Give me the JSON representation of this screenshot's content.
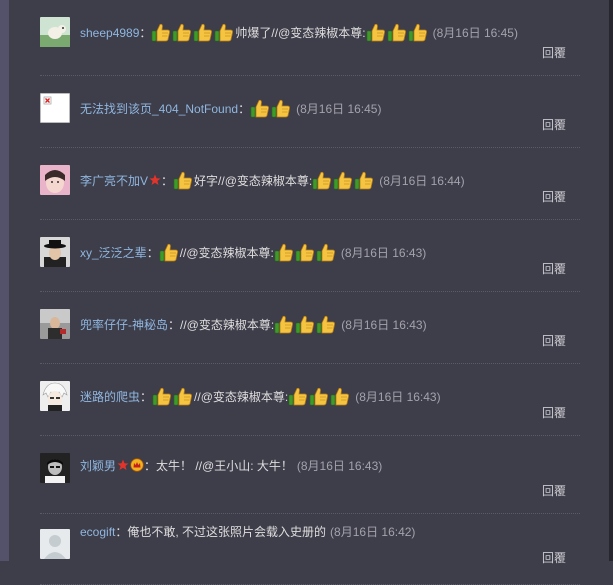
{
  "comments": [
    {
      "user": "sheep4989",
      "suffix": "：",
      "thumbs_a": 4,
      "text": "帅爆了//@变态辣椒本尊:",
      "thumbs_b": 3,
      "time": "(8月16日 16:45)",
      "reply": "回覆",
      "avatar": "sheep-avatar"
    },
    {
      "user": "无法找到该页_404_NotFound",
      "suffix": "：",
      "thumbs_a": 2,
      "text": "",
      "thumbs_b": 0,
      "time": "(8月16日 16:45)",
      "reply": "回覆",
      "avatar": "broken-image-avatar"
    },
    {
      "user": "李广亮不加V",
      "suffix": "：",
      "thumbs_a": 1,
      "text": "好字//@变态辣椒本尊:",
      "thumbs_b": 3,
      "time": "(8月16日 16:44)",
      "reply": "回覆",
      "avatar": "girl-avatar",
      "badge": "star-badge"
    },
    {
      "user": "xy_泛泛之辈",
      "suffix": "：",
      "thumbs_a": 1,
      "text": "//@变态辣椒本尊:",
      "thumbs_b": 3,
      "time": "(8月16日 16:43)",
      "reply": "回覆",
      "avatar": "hat-avatar"
    },
    {
      "user": "兜率仔仔-神秘岛",
      "suffix": "：",
      "thumbs_a": 0,
      "text": "//@变态辣椒本尊:",
      "thumbs_b": 3,
      "time": "(8月16日 16:43)",
      "reply": "回覆",
      "avatar": "photo-avatar"
    },
    {
      "user": "迷路的爬虫",
      "suffix": "：",
      "thumbs_a": 2,
      "text": "//@变态辣椒本尊:",
      "thumbs_b": 3,
      "time": "(8月16日 16:43)",
      "reply": "回覆",
      "avatar": "anime-avatar"
    },
    {
      "user": "刘颖男",
      "suffix": "：",
      "thumbs_a": 0,
      "text": "太牛！ //@王小山: 大牛！",
      "thumbs_b": 0,
      "time": "(8月16日 16:43)",
      "reply": "回覆",
      "avatar": "bw-avatar",
      "badge": "star-badge",
      "badge2": "crown-badge"
    },
    {
      "user": "ecogift",
      "suffix": "：",
      "thumbs_a": 0,
      "text": "俺也不敢, 不过这张照片会载入史册的",
      "thumbs_b": 0,
      "time": "(8月16日 16:42)",
      "reply": "回覆",
      "avatar": "default-avatar"
    }
  ],
  "colors": {
    "background": "#3e3d4a",
    "username": "#8fb7e0",
    "time": "#a3a3ac"
  }
}
